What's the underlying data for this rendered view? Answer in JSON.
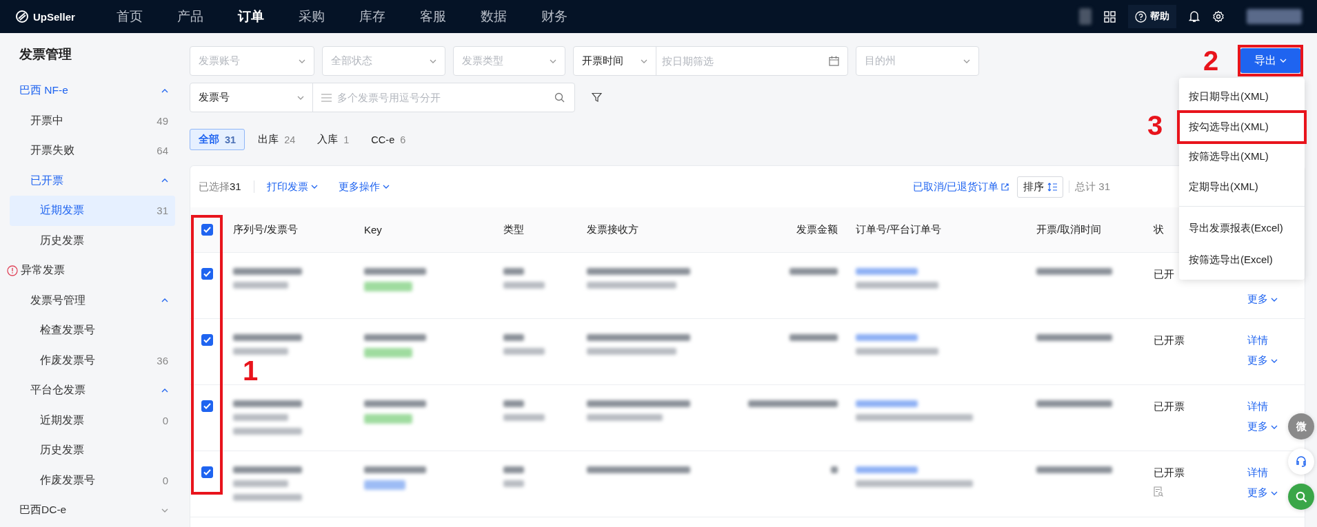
{
  "topbar": {
    "logo": "UpSeller",
    "nav": [
      {
        "label": "首页",
        "selected": false
      },
      {
        "label": "产品",
        "selected": false
      },
      {
        "label": "订单",
        "selected": true
      },
      {
        "label": "采购",
        "selected": false
      },
      {
        "label": "库存",
        "selected": false
      },
      {
        "label": "客服",
        "selected": false
      },
      {
        "label": "数据",
        "selected": false
      },
      {
        "label": "财务",
        "selected": false
      }
    ],
    "help": "帮助"
  },
  "sidebar": {
    "title": "发票管理",
    "items": [
      {
        "label": "巴西 NF-e",
        "expanded": true,
        "selected": false,
        "children": [
          {
            "label": "开票中",
            "count": "49",
            "selected": false
          },
          {
            "label": "开票失败",
            "count": "64",
            "selected": false
          },
          {
            "label": "已开票",
            "expanded": true,
            "selected": false,
            "children": [
              {
                "label": "近期发票",
                "count": "31",
                "selected": true
              },
              {
                "label": "历史发票",
                "selected": false
              }
            ]
          }
        ]
      },
      {
        "label": "异常发票",
        "kind": "warning",
        "selected": false,
        "children": [
          {
            "label": "发票号管理",
            "expanded": true,
            "selected": false,
            "children": [
              {
                "label": "检查发票号",
                "selected": false
              },
              {
                "label": "作废发票号",
                "count": "36",
                "selected": false
              }
            ]
          },
          {
            "label": "平台仓发票",
            "expanded": true,
            "selected": false,
            "children": [
              {
                "label": "近期发票",
                "count": "0",
                "selected": false
              },
              {
                "label": "历史发票",
                "selected": false
              },
              {
                "label": "作废发票号",
                "count": "0",
                "selected": false
              }
            ]
          }
        ]
      },
      {
        "label": "巴西DC-e",
        "expanded": false,
        "selected": false
      }
    ]
  },
  "filters": {
    "row1": [
      {
        "kind": "select",
        "placeholder": "发票账号"
      },
      {
        "kind": "select",
        "placeholder": "全部状态"
      },
      {
        "kind": "select",
        "placeholder": "发票类型"
      },
      {
        "kind": "date",
        "value": "开票时间",
        "placeholder": "按日期筛选"
      },
      {
        "kind": "select",
        "placeholder": "目的州"
      }
    ],
    "row2": {
      "select": "发票号",
      "placeholder": "多个发票号用逗号分开"
    }
  },
  "tabs": [
    {
      "label": "全部",
      "count": "31",
      "selected": true
    },
    {
      "label": "出库",
      "count": "24",
      "selected": false
    },
    {
      "label": "入库",
      "count": "1",
      "selected": false
    },
    {
      "label": "CC-e",
      "count": "6",
      "selected": false
    }
  ],
  "export": {
    "label": "导出",
    "menu": [
      {
        "label": "按日期导出(XML)",
        "selected": false
      },
      {
        "label": "按勾选导出(XML)",
        "selected": true
      },
      {
        "label": "按筛选导出(XML)",
        "selected": false
      },
      {
        "label": "定期导出(XML)",
        "selected": false
      },
      {
        "label": "导出发票报表(Excel)",
        "selected": false,
        "kind": "divided"
      },
      {
        "label": "按筛选导出(Excel)",
        "selected": false
      }
    ]
  },
  "toolbar": {
    "selected_label": "已选择",
    "selected_count": "31",
    "print": "打印发票",
    "more": "更多操作",
    "cancelled_link": "已取消/已退货订单",
    "sort": "排序",
    "total": "总计 31"
  },
  "table": {
    "all_checked": true,
    "columns": [
      "序列号/发票号",
      "Key",
      "类型",
      "发票接收方",
      "发票金额",
      "订单号/平台订单号",
      "开票/取消时间",
      "状"
    ],
    "rows": [
      {
        "checked": true,
        "status": "已开",
        "more": "更多"
      },
      {
        "checked": true,
        "status": "已开票",
        "detail": "详情",
        "more": "更多"
      },
      {
        "checked": true,
        "status": "已开票",
        "detail": "详情",
        "more": "更多"
      },
      {
        "checked": true,
        "status": "已开票",
        "detail": "详情",
        "more": "更多",
        "doc_icon": true
      }
    ]
  },
  "annotations": [
    "1",
    "2",
    "3"
  ],
  "float_buttons": {
    "wechat": "微"
  }
}
